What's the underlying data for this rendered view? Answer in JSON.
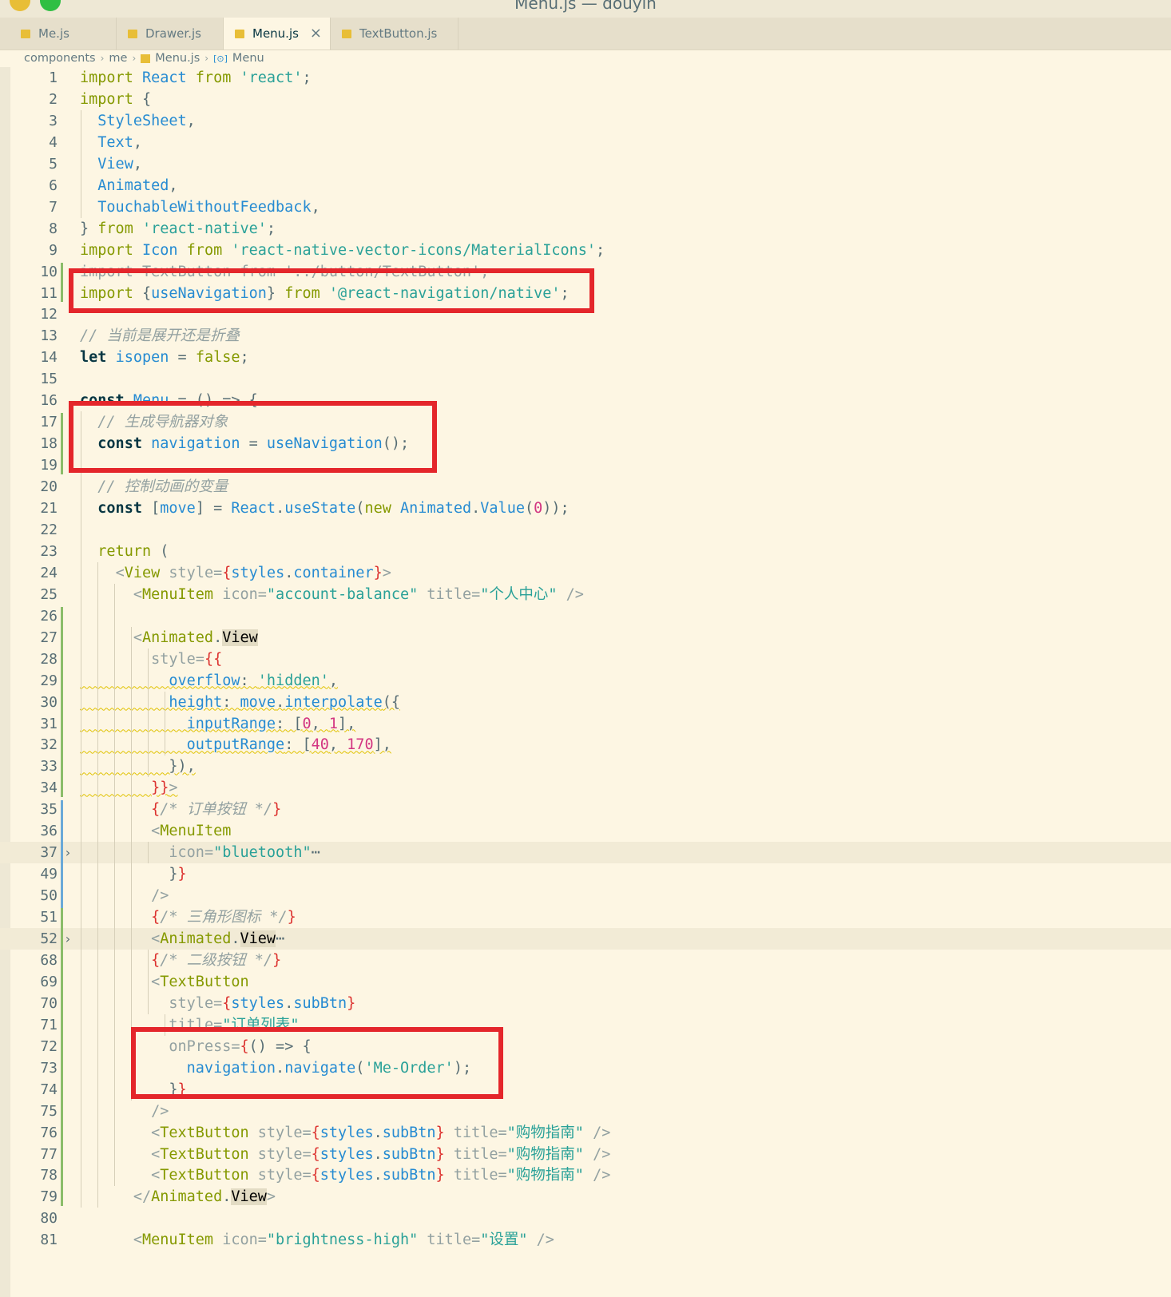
{
  "window": {
    "title": "Menu.js — douyin"
  },
  "tabs": [
    {
      "label": "Me.js"
    },
    {
      "label": "Drawer.js"
    },
    {
      "label": "Menu.js",
      "close": "×"
    },
    {
      "label": "TextButton.js"
    }
  ],
  "breadcrumb": {
    "parts": [
      "components",
      "me",
      "Menu.js",
      "Menu"
    ],
    "separator": "›",
    "file_badge": "JS",
    "symbol_badge": "[⊙]"
  },
  "fold_glyph": "›",
  "lines": [
    {
      "n": "1",
      "segs": [
        [
          "kw",
          "import "
        ],
        [
          "ty",
          "React "
        ],
        [
          "kw",
          "from "
        ],
        [
          "st",
          "'react'"
        ],
        [
          "pl",
          ";"
        ]
      ]
    },
    {
      "n": "2",
      "segs": [
        [
          "kw",
          "import "
        ],
        [
          "pl",
          "{"
        ]
      ]
    },
    {
      "n": "3",
      "segs": [
        [
          "pl",
          "  "
        ],
        [
          "ty",
          "StyleSheet"
        ],
        [
          "pl",
          ","
        ]
      ]
    },
    {
      "n": "4",
      "segs": [
        [
          "pl",
          "  "
        ],
        [
          "ty",
          "Text"
        ],
        [
          "pl",
          ","
        ]
      ]
    },
    {
      "n": "5",
      "segs": [
        [
          "pl",
          "  "
        ],
        [
          "ty",
          "View"
        ],
        [
          "pl",
          ","
        ]
      ]
    },
    {
      "n": "6",
      "segs": [
        [
          "pl",
          "  "
        ],
        [
          "ty",
          "Animated"
        ],
        [
          "pl",
          ","
        ]
      ]
    },
    {
      "n": "7",
      "segs": [
        [
          "pl",
          "  "
        ],
        [
          "ty",
          "TouchableWithoutFeedback"
        ],
        [
          "pl",
          ","
        ]
      ]
    },
    {
      "n": "8",
      "segs": [
        [
          "pl",
          "} "
        ],
        [
          "kw",
          "from "
        ],
        [
          "st",
          "'react-native'"
        ],
        [
          "pl",
          ";"
        ]
      ]
    },
    {
      "n": "9",
      "segs": [
        [
          "kw",
          "import "
        ],
        [
          "ty",
          "Icon "
        ],
        [
          "kw",
          "from "
        ],
        [
          "st",
          "'react-native-vector-icons/MaterialIcons'"
        ],
        [
          "pl",
          ";"
        ]
      ]
    },
    {
      "n": "10",
      "segs": [
        [
          "strike",
          "import TextButton from '../button/TextButton';"
        ]
      ]
    },
    {
      "n": "11",
      "segs": [
        [
          "kw",
          "import "
        ],
        [
          "pl",
          "{"
        ],
        [
          "ty",
          "useNavigation"
        ],
        [
          "pl",
          "} "
        ],
        [
          "kw",
          "from "
        ],
        [
          "st",
          "'@react-navigation/native'"
        ],
        [
          "pl",
          ";"
        ]
      ]
    },
    {
      "n": "12",
      "segs": []
    },
    {
      "n": "13",
      "segs": [
        [
          "cm",
          "// 当前是展开还是折叠"
        ]
      ]
    },
    {
      "n": "14",
      "segs": [
        [
          "kwb",
          "let "
        ],
        [
          "ty",
          "isopen "
        ],
        [
          "pl",
          "= "
        ],
        [
          "kw",
          "false"
        ],
        [
          "pl",
          ";"
        ]
      ]
    },
    {
      "n": "15",
      "segs": []
    },
    {
      "n": "16",
      "segs": [
        [
          "kwb",
          "const "
        ],
        [
          "ty",
          "Menu "
        ],
        [
          "pl",
          "= () => {"
        ]
      ]
    },
    {
      "n": "17",
      "segs": [
        [
          "pl",
          "  "
        ],
        [
          "cm",
          "// 生成导航器对象"
        ]
      ]
    },
    {
      "n": "18",
      "segs": [
        [
          "pl",
          "  "
        ],
        [
          "kwb",
          "const "
        ],
        [
          "ty",
          "navigation "
        ],
        [
          "pl",
          "= "
        ],
        [
          "fn",
          "useNavigation"
        ],
        [
          "pl",
          "();"
        ]
      ]
    },
    {
      "n": "19",
      "segs": []
    },
    {
      "n": "20",
      "segs": [
        [
          "pl",
          "  "
        ],
        [
          "cm",
          "// 控制动画的变量"
        ]
      ]
    },
    {
      "n": "21",
      "segs": [
        [
          "pl",
          "  "
        ],
        [
          "kwb",
          "const "
        ],
        [
          "pl",
          "["
        ],
        [
          "ty",
          "move"
        ],
        [
          "pl",
          "] = "
        ],
        [
          "ty",
          "React"
        ],
        [
          "pl",
          "."
        ],
        [
          "fn",
          "useState"
        ],
        [
          "pl",
          "("
        ],
        [
          "kw",
          "new "
        ],
        [
          "ty",
          "Animated"
        ],
        [
          "pl",
          "."
        ],
        [
          "fn",
          "Value"
        ],
        [
          "pl",
          "("
        ],
        [
          "nm",
          "0"
        ],
        [
          "pl",
          "));"
        ]
      ]
    },
    {
      "n": "22",
      "segs": []
    },
    {
      "n": "23",
      "segs": [
        [
          "pl",
          "  "
        ],
        [
          "kw",
          "return "
        ],
        [
          "pl",
          "("
        ]
      ]
    },
    {
      "n": "24",
      "segs": [
        [
          "pl",
          "    "
        ],
        [
          "at",
          "<"
        ],
        [
          "tg",
          "View "
        ],
        [
          "at",
          "style="
        ],
        [
          "br",
          "{"
        ],
        [
          "ty",
          "styles"
        ],
        [
          "pl",
          "."
        ],
        [
          "ty",
          "container"
        ],
        [
          "br",
          "}"
        ],
        [
          "at",
          ">"
        ]
      ]
    },
    {
      "n": "25",
      "segs": [
        [
          "pl",
          "      "
        ],
        [
          "at",
          "<"
        ],
        [
          "tg",
          "MenuItem "
        ],
        [
          "at",
          "icon="
        ],
        [
          "st",
          "\"account-balance\" "
        ],
        [
          "at",
          "title="
        ],
        [
          "st",
          "\"个人中心\" "
        ],
        [
          "at",
          "/>"
        ]
      ]
    },
    {
      "n": "26",
      "segs": []
    },
    {
      "n": "27",
      "segs": [
        [
          "pl",
          "      "
        ],
        [
          "at",
          "<"
        ],
        [
          "tg",
          "Animated"
        ],
        [
          "pl",
          "."
        ],
        [
          "hlword",
          "View"
        ]
      ]
    },
    {
      "n": "28",
      "segs": [
        [
          "pl",
          "        "
        ],
        [
          "at",
          "style="
        ],
        [
          "br",
          "{{"
        ]
      ]
    },
    {
      "n": "29",
      "segs": [
        [
          "pl",
          "          "
        ],
        [
          "ty",
          "overflow"
        ],
        [
          "pl",
          ": "
        ],
        [
          "st",
          "'hidden'"
        ],
        [
          "pl",
          ","
        ]
      ]
    },
    {
      "n": "30",
      "segs": [
        [
          "pl",
          "          "
        ],
        [
          "ty",
          "height"
        ],
        [
          "pl",
          ": "
        ],
        [
          "ty",
          "move"
        ],
        [
          "pl",
          "."
        ],
        [
          "fn",
          "interpolate"
        ],
        [
          "pl",
          "({"
        ]
      ]
    },
    {
      "n": "31",
      "segs": [
        [
          "pl",
          "            "
        ],
        [
          "ty",
          "inputRange"
        ],
        [
          "pl",
          ": ["
        ],
        [
          "nm",
          "0"
        ],
        [
          "pl",
          ", "
        ],
        [
          "nm",
          "1"
        ],
        [
          "pl",
          "],"
        ]
      ]
    },
    {
      "n": "32",
      "segs": [
        [
          "pl",
          "            "
        ],
        [
          "ty",
          "outputRange"
        ],
        [
          "pl",
          ": ["
        ],
        [
          "nm",
          "40"
        ],
        [
          "pl",
          ", "
        ],
        [
          "nm",
          "170"
        ],
        [
          "pl",
          "],"
        ]
      ]
    },
    {
      "n": "33",
      "segs": [
        [
          "pl",
          "          }),"
        ]
      ]
    },
    {
      "n": "34",
      "segs": [
        [
          "pl",
          "        "
        ],
        [
          "br",
          "}}"
        ],
        [
          "at",
          ">"
        ]
      ]
    },
    {
      "n": "35",
      "segs": [
        [
          "pl",
          "        "
        ],
        [
          "br",
          "{"
        ],
        [
          "cm",
          "/* 订单按钮 */"
        ],
        [
          "br",
          "}"
        ]
      ]
    },
    {
      "n": "36",
      "segs": [
        [
          "pl",
          "        "
        ],
        [
          "at",
          "<"
        ],
        [
          "tg",
          "MenuItem"
        ]
      ]
    },
    {
      "n": "37",
      "segs": [
        [
          "pl",
          "          "
        ],
        [
          "at",
          "icon="
        ],
        [
          "st",
          "\"bluetooth\""
        ],
        [
          "pl",
          "⋯"
        ]
      ]
    },
    {
      "n": "49",
      "segs": [
        [
          "pl",
          "          }"
        ],
        [
          "br",
          "}"
        ]
      ]
    },
    {
      "n": "50",
      "segs": [
        [
          "pl",
          "        "
        ],
        [
          "at",
          "/>"
        ]
      ]
    },
    {
      "n": "51",
      "segs": [
        [
          "pl",
          "        "
        ],
        [
          "br",
          "{"
        ],
        [
          "cm",
          "/* 三角形图标 */"
        ],
        [
          "br",
          "}"
        ]
      ]
    },
    {
      "n": "52",
      "segs": [
        [
          "pl",
          "        "
        ],
        [
          "at",
          "<"
        ],
        [
          "tg",
          "Animated"
        ],
        [
          "pl",
          "."
        ],
        [
          "hlword",
          "View"
        ],
        [
          "pl",
          "⋯"
        ]
      ]
    },
    {
      "n": "68",
      "segs": [
        [
          "pl",
          "        "
        ],
        [
          "br",
          "{"
        ],
        [
          "cm",
          "/* 二级按钮 */"
        ],
        [
          "br",
          "}"
        ]
      ]
    },
    {
      "n": "69",
      "segs": [
        [
          "pl",
          "        "
        ],
        [
          "at",
          "<"
        ],
        [
          "tg",
          "TextButton"
        ]
      ]
    },
    {
      "n": "70",
      "segs": [
        [
          "pl",
          "          "
        ],
        [
          "at",
          "style="
        ],
        [
          "br",
          "{"
        ],
        [
          "ty",
          "styles"
        ],
        [
          "pl",
          "."
        ],
        [
          "ty",
          "subBtn"
        ],
        [
          "br",
          "}"
        ]
      ]
    },
    {
      "n": "71",
      "segs": [
        [
          "pl",
          "          "
        ],
        [
          "at",
          "title="
        ],
        [
          "st",
          "\"订单列表\""
        ]
      ]
    },
    {
      "n": "72",
      "segs": [
        [
          "pl",
          "          "
        ],
        [
          "at",
          "onPress="
        ],
        [
          "br",
          "{"
        ],
        [
          "pl",
          "() => {"
        ]
      ]
    },
    {
      "n": "73",
      "segs": [
        [
          "pl",
          "            "
        ],
        [
          "ty",
          "navigation"
        ],
        [
          "pl",
          "."
        ],
        [
          "fn",
          "navigate"
        ],
        [
          "pl",
          "("
        ],
        [
          "st",
          "'Me-Order'"
        ],
        [
          "pl",
          ");"
        ]
      ]
    },
    {
      "n": "74",
      "segs": [
        [
          "pl",
          "          }"
        ],
        [
          "br",
          "}"
        ]
      ]
    },
    {
      "n": "75",
      "segs": [
        [
          "pl",
          "        "
        ],
        [
          "at",
          "/>"
        ]
      ]
    },
    {
      "n": "76",
      "segs": [
        [
          "pl",
          "        "
        ],
        [
          "at",
          "<"
        ],
        [
          "tg",
          "TextButton "
        ],
        [
          "at",
          "style="
        ],
        [
          "br",
          "{"
        ],
        [
          "ty",
          "styles"
        ],
        [
          "pl",
          "."
        ],
        [
          "ty",
          "subBtn"
        ],
        [
          "br",
          "} "
        ],
        [
          "at",
          "title="
        ],
        [
          "st",
          "\"购物指南\" "
        ],
        [
          "at",
          "/>"
        ]
      ]
    },
    {
      "n": "77",
      "segs": [
        [
          "pl",
          "        "
        ],
        [
          "at",
          "<"
        ],
        [
          "tg",
          "TextButton "
        ],
        [
          "at",
          "style="
        ],
        [
          "br",
          "{"
        ],
        [
          "ty",
          "styles"
        ],
        [
          "pl",
          "."
        ],
        [
          "ty",
          "subBtn"
        ],
        [
          "br",
          "} "
        ],
        [
          "at",
          "title="
        ],
        [
          "st",
          "\"购物指南\" "
        ],
        [
          "at",
          "/>"
        ]
      ]
    },
    {
      "n": "78",
      "segs": [
        [
          "pl",
          "        "
        ],
        [
          "at",
          "<"
        ],
        [
          "tg",
          "TextButton "
        ],
        [
          "at",
          "style="
        ],
        [
          "br",
          "{"
        ],
        [
          "ty",
          "styles"
        ],
        [
          "pl",
          "."
        ],
        [
          "ty",
          "subBtn"
        ],
        [
          "br",
          "} "
        ],
        [
          "at",
          "title="
        ],
        [
          "st",
          "\"购物指南\" "
        ],
        [
          "at",
          "/>"
        ]
      ]
    },
    {
      "n": "79",
      "segs": [
        [
          "pl",
          "      "
        ],
        [
          "at",
          "</"
        ],
        [
          "tg",
          "Animated"
        ],
        [
          "pl",
          "."
        ],
        [
          "hlword",
          "View"
        ],
        [
          "at",
          ">"
        ]
      ]
    },
    {
      "n": "80",
      "segs": []
    },
    {
      "n": "81",
      "segs": [
        [
          "pl",
          "      "
        ],
        [
          "at",
          "<"
        ],
        [
          "tg",
          "MenuItem "
        ],
        [
          "at",
          "icon="
        ],
        [
          "st",
          "\"brightness-high\" "
        ],
        [
          "at",
          "title="
        ],
        [
          "st",
          "\"设置\" "
        ],
        [
          "at",
          "/>"
        ]
      ]
    }
  ]
}
